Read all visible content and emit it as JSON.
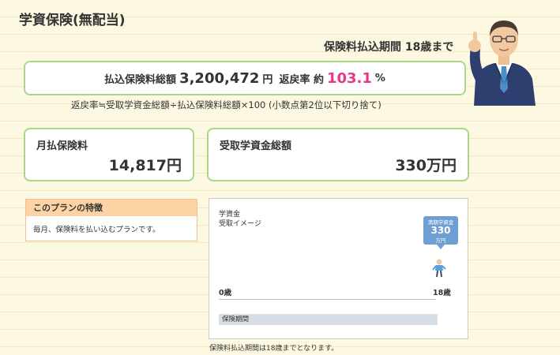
{
  "page_title": "学資保険(無配当)",
  "payment_period_label": "保険料払込期間 18歳まで",
  "summary": {
    "total_label": "払込保険料総額",
    "total_value": "3,200,472",
    "total_unit": "円",
    "rate_label": "返戻率 約",
    "rate_value": "103.1",
    "rate_unit": "%"
  },
  "formula": "返戻率≒受取学資金総額÷払込保険料総額×100 (小数点第2位以下切り捨て)",
  "monthly": {
    "label": "月払保険料",
    "value": "14,817円"
  },
  "benefit": {
    "label": "受取学資金総額",
    "value": "330万円"
  },
  "feature": {
    "header": "このプランの特徴",
    "body": "毎月、保険料を払い込むプランです。"
  },
  "chart": {
    "title_line1": "学資金",
    "title_line2": "受取イメージ",
    "bubble_label": "満期学資金",
    "bubble_value": "330",
    "bubble_unit": "万円",
    "age_start": "0歳",
    "age_end": "18歳",
    "period_bar_label": "保険期間"
  },
  "footnote": "保険料払込期間は18歳までとなります。",
  "colors": {
    "accent_pink": "#e8388a",
    "border_green": "#a8d888",
    "bubble_blue": "#6e9fd3",
    "feature_orange": "#fbd3a4"
  }
}
